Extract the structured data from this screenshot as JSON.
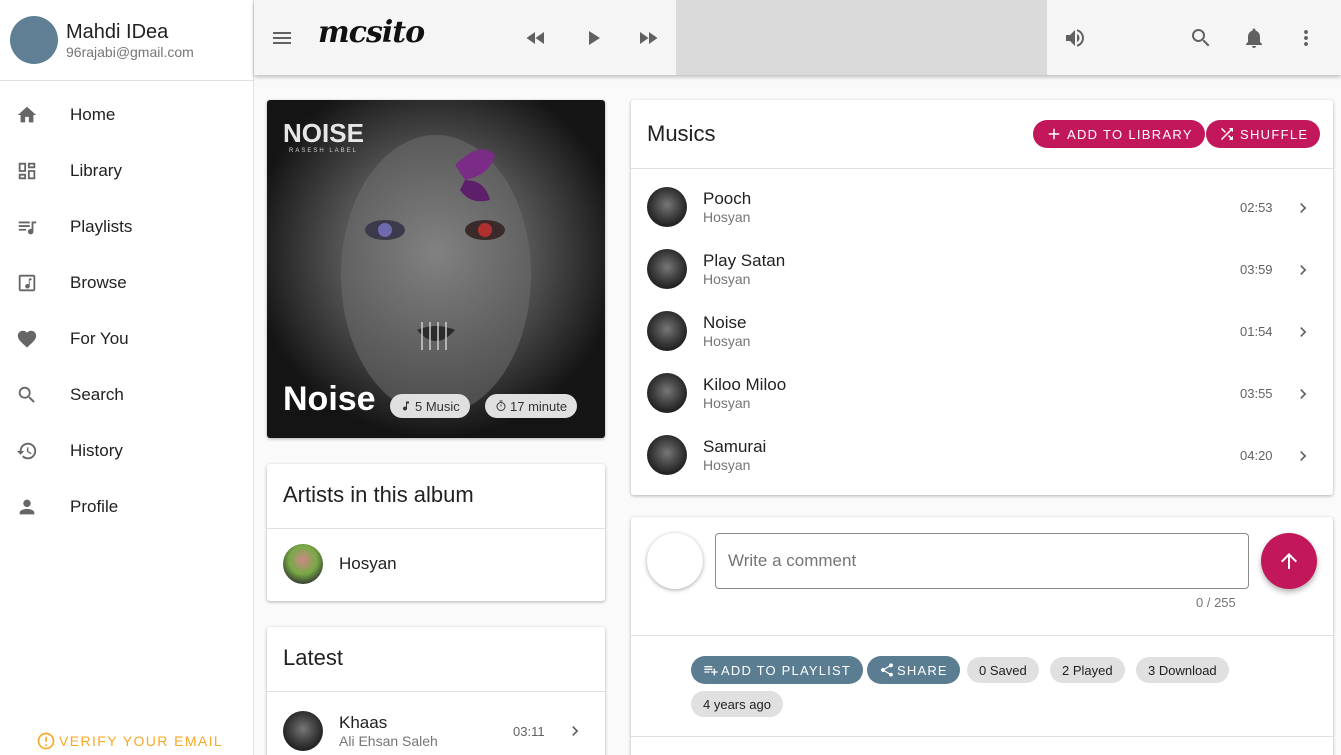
{
  "user": {
    "name": "Mahdi IDea",
    "email": "96rajabi@gmail.com"
  },
  "nav": [
    {
      "label": "Home",
      "icon": "home-icon"
    },
    {
      "label": "Library",
      "icon": "library-icon"
    },
    {
      "label": "Playlists",
      "icon": "playlist-icon"
    },
    {
      "label": "Browse",
      "icon": "browse-icon"
    },
    {
      "label": "For You",
      "icon": "heart-icon"
    },
    {
      "label": "Search",
      "icon": "search-icon"
    },
    {
      "label": "History",
      "icon": "history-icon"
    },
    {
      "label": "Profile",
      "icon": "person-icon"
    }
  ],
  "verify_label": "VERIFY YOUR EMAIL",
  "appbar": {
    "logo": "mcsito"
  },
  "album": {
    "title": "Noise",
    "cover_text": "NOISE",
    "cover_subtext": "RASESH LABEL",
    "music_count": "5 Music",
    "duration": "17 minute"
  },
  "artists_card": {
    "title": "Artists in this album",
    "artists": [
      {
        "name": "Hosyan"
      }
    ]
  },
  "latest_card": {
    "title": "Latest",
    "items": [
      {
        "title": "Khaas",
        "artist": "Ali Ehsan Saleh",
        "duration": "03:11"
      }
    ]
  },
  "musics": {
    "title": "Musics",
    "add_label": "ADD TO LIBRARY",
    "shuffle_label": "SHUFFLE",
    "tracks": [
      {
        "title": "Pooch",
        "artist": "Hosyan",
        "duration": "02:53"
      },
      {
        "title": "Play Satan",
        "artist": "Hosyan",
        "duration": "03:59"
      },
      {
        "title": "Noise",
        "artist": "Hosyan",
        "duration": "01:54"
      },
      {
        "title": "Kiloo Miloo",
        "artist": "Hosyan",
        "duration": "03:55"
      },
      {
        "title": "Samurai",
        "artist": "Hosyan",
        "duration": "04:20"
      }
    ]
  },
  "comment": {
    "placeholder": "Write a comment",
    "counter": "0 / 255"
  },
  "actions": {
    "add_playlist": "ADD TO PLAYLIST",
    "share": "SHARE",
    "saved": "0 Saved",
    "played": "2 Played",
    "download": "3 Download",
    "age": "4 years ago"
  },
  "colors": {
    "accent": "#c2185b",
    "secondary": "#5a7d91",
    "warning": "#f9a825"
  }
}
